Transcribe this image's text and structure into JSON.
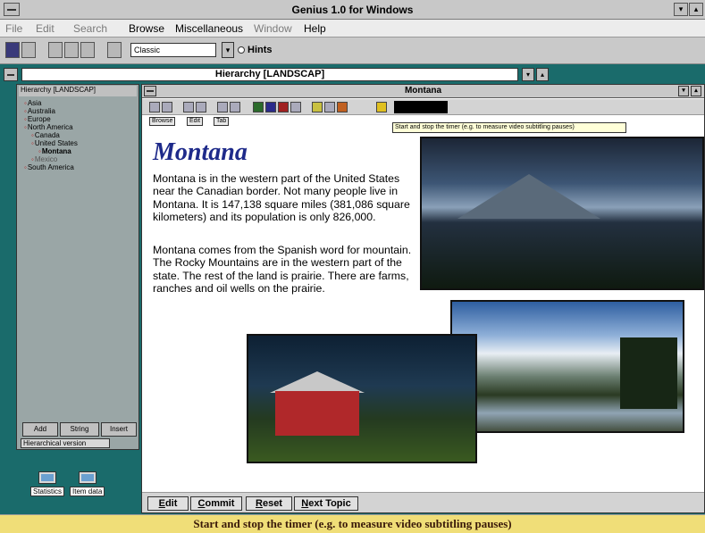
{
  "window": {
    "title": "Genius 1.0 for Windows",
    "min": "▾",
    "max": "▴"
  },
  "menu": [
    {
      "label": "File",
      "enabled": false
    },
    {
      "label": "Edit",
      "enabled": false
    },
    {
      "label": "Search",
      "enabled": false
    },
    {
      "label": "Browse",
      "enabled": true
    },
    {
      "label": "Miscellaneous",
      "enabled": true
    },
    {
      "label": "Window",
      "enabled": false
    },
    {
      "label": "Help",
      "enabled": true
    }
  ],
  "toolbar": {
    "mode_value": "Classic",
    "dropdown_glyph": "▾",
    "hints_label": "Hints"
  },
  "hierarchy": {
    "title": "Hierarchy [LANDSCAP]",
    "head": "Hierarchy [LANDSCAP]",
    "items": [
      {
        "label": "Asia",
        "selected": false,
        "dim": false
      },
      {
        "label": "Australia",
        "selected": false,
        "dim": false
      },
      {
        "label": "Europe",
        "selected": false,
        "dim": false
      },
      {
        "label": "North America",
        "selected": false,
        "dim": false
      },
      {
        "label": "Canada",
        "selected": false,
        "dim": false
      },
      {
        "label": "United States",
        "selected": false,
        "dim": false
      },
      {
        "label": "Montana",
        "selected": true,
        "dim": false
      },
      {
        "label": "Mexico",
        "selected": false,
        "dim": true
      },
      {
        "label": "South America",
        "selected": false,
        "dim": false
      }
    ],
    "buttons": [
      "Add",
      "String",
      "Insert"
    ],
    "tab_label": "Hierarchical version"
  },
  "desktop_icons": [
    {
      "label": "Statistics"
    },
    {
      "label": "Item data"
    }
  ],
  "document": {
    "window_title": "Montana",
    "tabs": [
      "Browse",
      "Edit",
      "Tab"
    ],
    "tooltip": "Start and stop the timer (e.g. to measure video subtitling pauses)",
    "heading": "Montana",
    "paragraphs": [
      "Montana is in the western part of the United States near the Canadian border. Not many people live in Montana. It is 147,138 square miles (381,086 square kilometers) and its population is only 826,000.",
      "Montana comes from the Spanish word for mountain. The Rocky Mountains are in the western part of the state. The rest of the land is prairie. There are farms, ranches and oil wells on the prairie."
    ],
    "buttons": [
      {
        "underline": "E",
        "rest": "dit"
      },
      {
        "underline": "C",
        "rest": "ommit"
      },
      {
        "underline": "R",
        "rest": "eset"
      },
      {
        "underline": "N",
        "rest": "ext Topic"
      }
    ]
  },
  "status": {
    "text": "Start and stop the timer (e.g. to measure video subtitling pauses)"
  }
}
